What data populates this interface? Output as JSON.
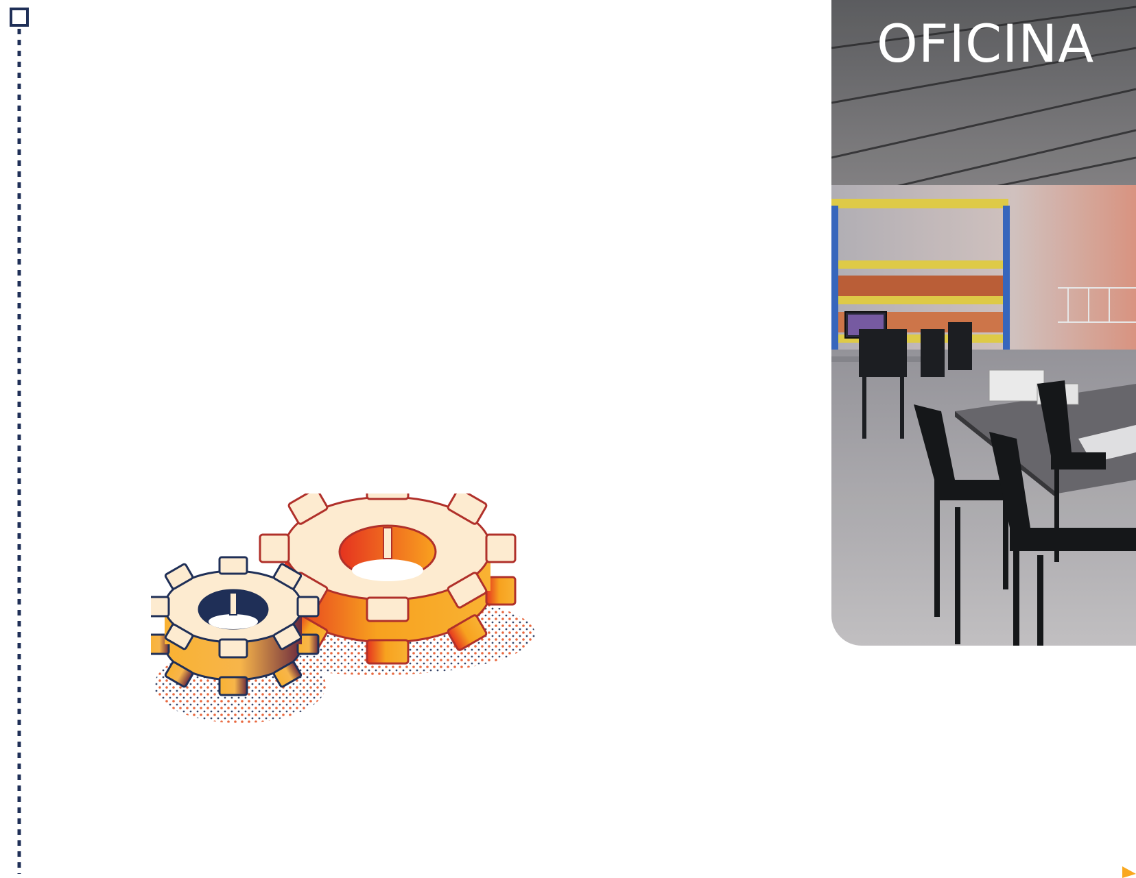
{
  "photo": {
    "title": "OFICINA",
    "description_name": "office-photo"
  },
  "colors": {
    "navy": "#1f2f57",
    "orange": "#f2801c",
    "red": "#e53a1f",
    "yellow": "#f9b233",
    "cream": "#fdebd0"
  }
}
